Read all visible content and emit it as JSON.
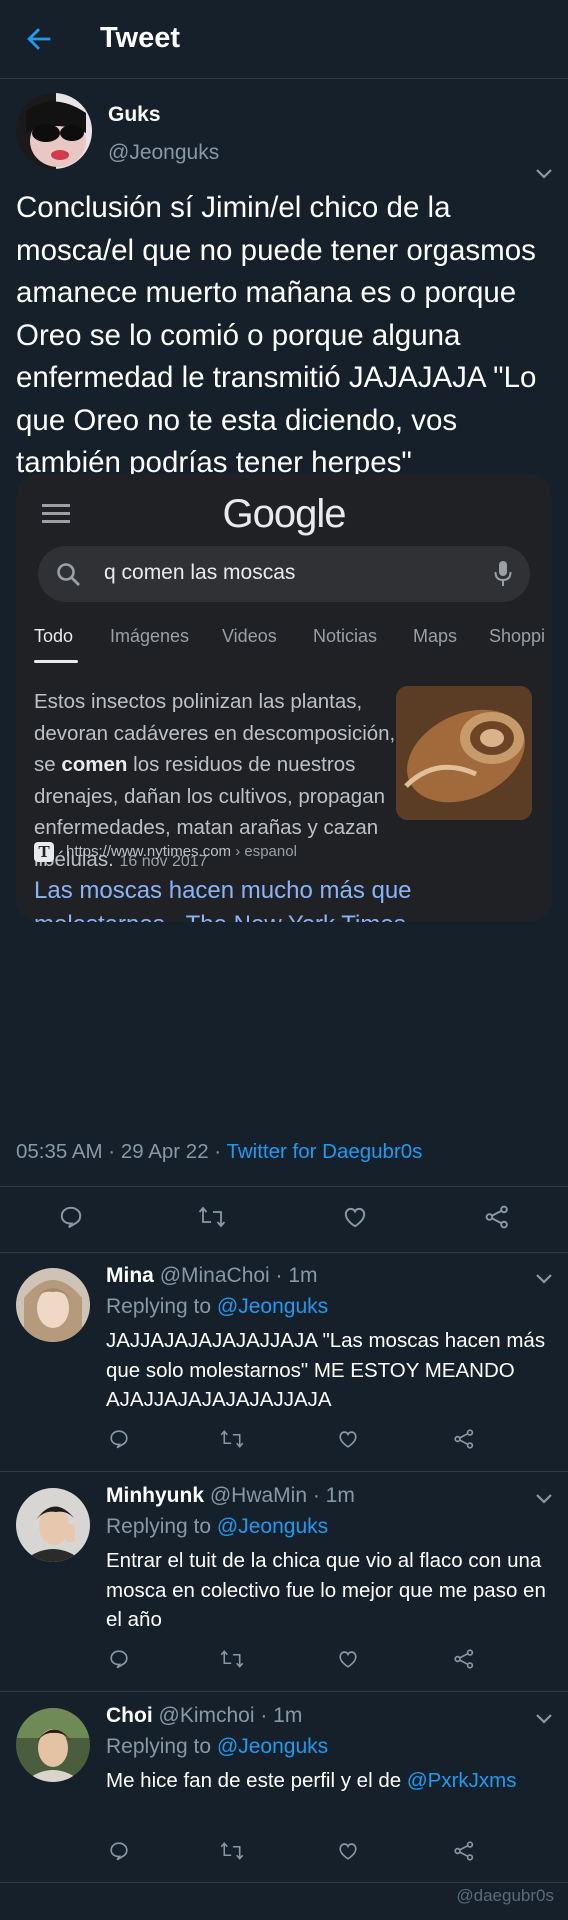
{
  "header": {
    "title": "Tweet",
    "back_icon": "arrow-left-icon"
  },
  "main_tweet": {
    "name": "Guks",
    "handle": "@Jeonguks",
    "text": "Conclusión sí Jimin/el chico de la mosca/el que no puede tener orgasmos amanece muerto mañana es o porque Oreo se lo comió o porque alguna enfermedad le transmitió JAJAJAJA \"Lo que Oreo no te esta diciendo, vos también podrías tener herpes\"",
    "time": "05:35 AM · 29 Apr 22 · ",
    "client": "Twitter for Daegubr0s"
  },
  "google_card": {
    "logo": "Google",
    "query": "q comen las moscas",
    "tabs": [
      "Todo",
      "Imágenes",
      "Videos",
      "Noticias",
      "Maps",
      "Shoppi"
    ],
    "snippet_before": "Estos insectos polinizan las plantas, devoran cadáveres en descomposición, se ",
    "snippet_bold": "comen",
    "snippet_after": " los residuos de nuestros drenajes, dañan los cultivos, propagan enfermedades, matan arañas y cazan libélulas.",
    "snippet_date": "16 nov 2017",
    "favicon_letter": "T",
    "url": "https://www.nytimes.com",
    "url_path": " › espanol",
    "result_title": "Las moscas hacen mucho más que molestarnos - The New York Times"
  },
  "replies": [
    {
      "name": "Mina",
      "handle": "@MinaChoi · 1m",
      "replying_label": "Replying to ",
      "replying_to": "@Jeonguks",
      "text": "JAJJAJAJAJAJAJJAJA \"Las moscas hacen más que solo molestarnos\" ME ESTOY MEANDO AJAJJAJAJAJAJAJJAJA"
    },
    {
      "name": "Minhyunk",
      "handle": "@HwaMin · 1m",
      "replying_label": "Replying to ",
      "replying_to": "@Jeonguks",
      "text": "Entrar el tuit de la chica que vio al flaco con una mosca en colectivo fue lo mejor que me paso en el año"
    },
    {
      "name": "Choi",
      "handle": "@Kimchoi · 1m",
      "replying_label": "Replying to ",
      "replying_to": "@Jeonguks",
      "text": "Me hice fan de este perfil y el de ",
      "text_mention": "@PxrkJxms"
    }
  ],
  "watermark": "@daegubr0s",
  "colors": {
    "background": "#15202b",
    "accent": "#1d9bf0",
    "muted": "#8899a6",
    "card": "#202124",
    "link": "#8ab4f8"
  }
}
